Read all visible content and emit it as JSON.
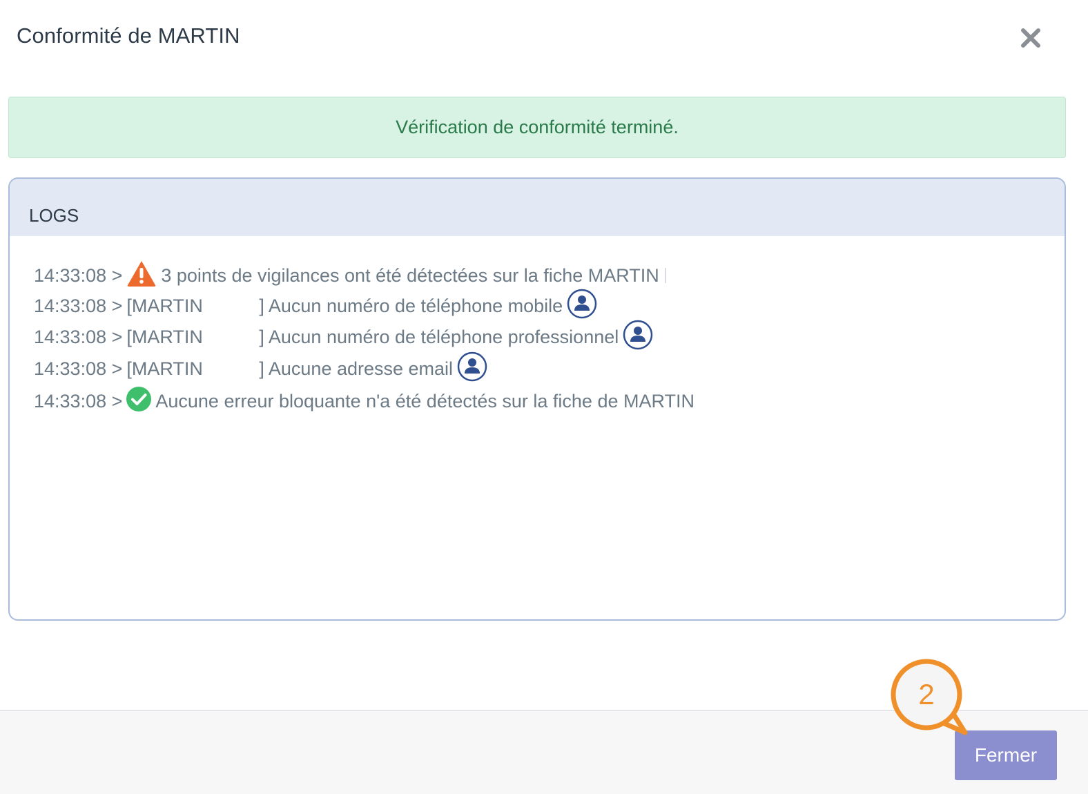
{
  "header": {
    "title": "Conformité de MARTIN",
    "close_icon": "close-icon"
  },
  "alert": {
    "message": "Vérification de conformité terminé.",
    "color": "#2a7a4b",
    "background": "#d8f2e3"
  },
  "logs": {
    "title": "LOGS",
    "lines": [
      {
        "time": "14:33:08 >",
        "icon": "warning-icon",
        "text": "3 points de vigilances ont été détectées sur la fiche MARTIN"
      },
      {
        "time": "14:33:08 >",
        "name": "[MARTIN",
        "text": "] Aucun numéro de téléphone mobile",
        "icon": "user-icon"
      },
      {
        "time": "14:33:08 >",
        "name": "[MARTIN",
        "text": "] Aucun numéro de téléphone professionnel",
        "icon": "user-icon"
      },
      {
        "time": "14:33:08 >",
        "name": "[MARTIN",
        "text": "] Aucune adresse email",
        "icon": "user-icon"
      },
      {
        "time": "14:33:08 >",
        "icon": "check-circle-icon",
        "text": "Aucune erreur bloquante n'a été détectés sur la fiche de MARTIN"
      }
    ]
  },
  "footer": {
    "close_label": "Fermer",
    "button_color": "#8b8ecf"
  },
  "annotation": {
    "step": "2",
    "color": "#f0902b"
  }
}
